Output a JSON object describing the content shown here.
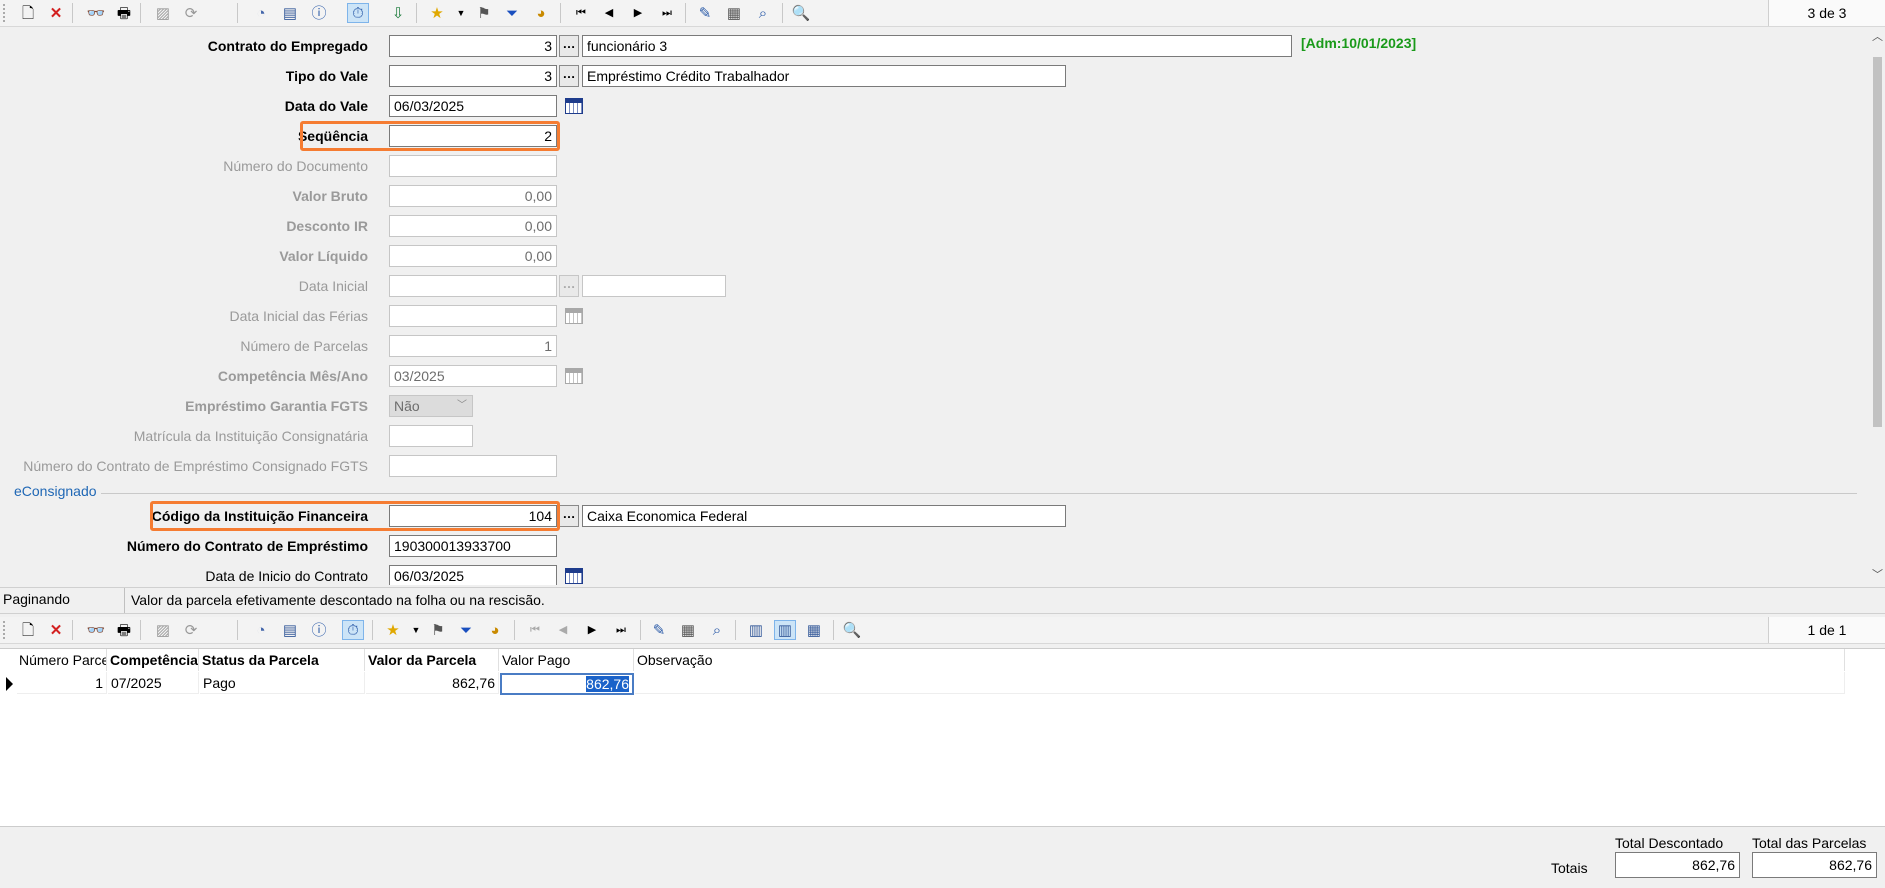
{
  "toolbar_top": {
    "record_counter": "3 de 3"
  },
  "form": {
    "contrato_empregado": {
      "label": "Contrato do Empregado",
      "code": "3",
      "name": "funcionário 3"
    },
    "admission_tag": "[Adm:10/01/2023]",
    "tipo_vale": {
      "label": "Tipo do Vale",
      "code": "3",
      "name": "Empréstimo Crédito Trabalhador"
    },
    "data_vale": {
      "label": "Data do Vale",
      "value": "06/03/2025"
    },
    "sequencia": {
      "label": "Seqüência",
      "value": "2"
    },
    "numero_documento": {
      "label": "Número do Documento",
      "value": ""
    },
    "valor_bruto": {
      "label": "Valor Bruto",
      "value": "0,00"
    },
    "desconto_ir": {
      "label": "Desconto IR",
      "value": "0,00"
    },
    "valor_liquido": {
      "label": "Valor Líquido",
      "value": "0,00"
    },
    "data_inicial": {
      "label": "Data Inicial",
      "value": ""
    },
    "data_inicial_ferias": {
      "label": "Data Inicial das Férias",
      "value": ""
    },
    "numero_parcelas": {
      "label": "Número de Parcelas",
      "value": "1"
    },
    "competencia": {
      "label": "Competência Mês/Ano",
      "value": "03/2025"
    },
    "garantia_fgts": {
      "label": "Empréstimo Garantia FGTS",
      "value": "Não"
    },
    "matricula_inst": {
      "label": "Matrícula da Instituição Consignatária",
      "value": ""
    },
    "numero_contrato_fgts": {
      "label": "Número do Contrato de Empréstimo Consignado FGTS",
      "value": ""
    },
    "section_econsignado": "eConsignado",
    "codigo_instituicao": {
      "label": "Código da Instituição Financeira",
      "code": "104",
      "name": "Caixa Economica Federal"
    },
    "numero_contrato": {
      "label": "Número do Contrato de Empréstimo",
      "value": "190300013933700"
    },
    "data_inicio_contrato": {
      "label": "Data de Inicio do Contrato",
      "value": "06/03/2025"
    }
  },
  "status": {
    "mode": "Paginando",
    "hint": "Valor da parcela efetivamente descontado na folha ou na rescisão."
  },
  "toolbar_bottom": {
    "record_counter": "1 de 1"
  },
  "grid": {
    "columns": [
      "Número Parcela",
      "Competência",
      "Status da Parcela",
      "Valor da Parcela",
      "Valor Pago",
      "Observação"
    ],
    "rows": [
      {
        "numero": "1",
        "competencia": "07/2025",
        "status": "Pago",
        "valor": "862,76",
        "pago": "862,76",
        "obs": ""
      }
    ]
  },
  "totals": {
    "label": "Totais",
    "descontado_label": "Total Descontado",
    "descontado": "862,76",
    "parcelas_label": "Total das Parcelas",
    "parcelas": "862,76"
  },
  "colors": {
    "highlight": "#f57c32",
    "admission": "#1a9a1a",
    "section": "#1f67b5"
  }
}
